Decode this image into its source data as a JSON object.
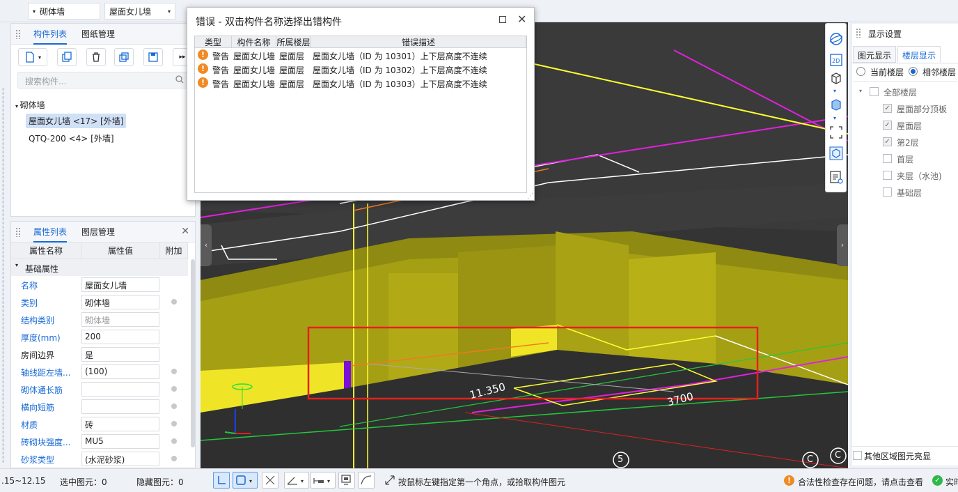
{
  "topbar": {
    "combo1": "砌体墙",
    "combo2": "屋面女儿墙"
  },
  "component_panel": {
    "tabs": [
      "构件列表",
      "图纸管理"
    ],
    "search_placeholder": "搜索构件...",
    "tree_root": "砌体墙",
    "tree_items": [
      "屋面女儿墙 <17> [外墙]",
      "QTQ-200 <4> [外墙]"
    ]
  },
  "property_panel": {
    "tabs": [
      "属性列表",
      "图层管理"
    ],
    "headers": [
      "属性名称",
      "属性值",
      "附加"
    ],
    "group": "基础属性",
    "rows": [
      {
        "name": "名称",
        "value": "屋面女儿墙"
      },
      {
        "name": "类别",
        "value": "砌体墙"
      },
      {
        "name": "结构类别",
        "value": "砌体墙"
      },
      {
        "name": "厚度(mm)",
        "value": "200"
      },
      {
        "name": "房间边界",
        "value": "是"
      },
      {
        "name": "轴线距左墙...",
        "value": "(100)"
      },
      {
        "name": "砌体通长筋",
        "value": ""
      },
      {
        "name": "横向短筋",
        "value": ""
      },
      {
        "name": "材质",
        "value": "砖"
      },
      {
        "name": "砖砌块强度...",
        "value": "MU5"
      },
      {
        "name": "砂浆类型",
        "value": "(水泥砂浆)"
      }
    ]
  },
  "error_dialog": {
    "title": "错误 - 双击构件名称选择出错构件",
    "headers": [
      "类型",
      "构件名称",
      "所属楼层",
      "错误描述"
    ],
    "rows": [
      {
        "type": "警告",
        "name": "屋面女儿墙",
        "floor": "屋面层",
        "desc": "屋面女儿墙（ID 为 10301）上下层高度不连续"
      },
      {
        "type": "警告",
        "name": "屋面女儿墙",
        "floor": "屋面层",
        "desc": "屋面女儿墙（ID 为 10302）上下层高度不连续"
      },
      {
        "type": "警告",
        "name": "屋面女儿墙",
        "floor": "屋面层",
        "desc": "屋面女儿墙（ID 为 10303）上下层高度不连续"
      }
    ]
  },
  "viewport": {
    "label_1": "11.350",
    "label_2": "3700",
    "axis_5": "5",
    "axis_c1": "C",
    "axis_c2": "C"
  },
  "display_panel": {
    "title": "显示设置",
    "tabs": [
      "图元显示",
      "楼层显示"
    ],
    "radio1": "当前楼层",
    "radio2": "相邻楼层",
    "tree_root": "全部楼层",
    "floors": [
      {
        "label": "屋面部分顶板",
        "checked": true
      },
      {
        "label": "屋面层",
        "checked": true
      },
      {
        "label": "第2层",
        "checked": true
      },
      {
        "label": "首层",
        "checked": false
      },
      {
        "label": "夹层（水池)",
        "checked": false
      },
      {
        "label": "基础层",
        "checked": false
      }
    ],
    "other_region": "其他区域图元亮显"
  },
  "status_bar": {
    "range": ".15~12.15",
    "selected": "选中图元：0",
    "hidden": "隐藏图元：0",
    "hint": "按鼠标左键指定第一个角点，或拾取构件图元",
    "check_msg": "合法性检查存在问题，请点击查看",
    "realtime": "实时"
  },
  "colors": {
    "accent": "#1769d6",
    "wall_yellow": "#c9c21a",
    "warn_orange": "#f08a24",
    "selection_red": "#e8201a"
  }
}
